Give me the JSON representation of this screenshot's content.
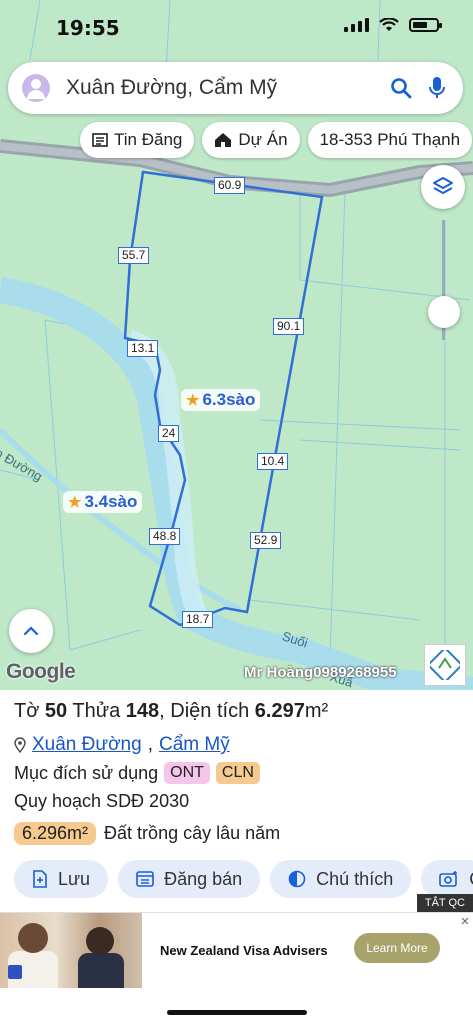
{
  "status": {
    "time": "19:55"
  },
  "search": {
    "query": "Xuân Đường, Cẩm Mỹ"
  },
  "chips": [
    {
      "label": "Tin Đăng",
      "icon": "news-icon"
    },
    {
      "label": "Dự Án",
      "icon": "house-icon"
    },
    {
      "label": "18-353 Phú Thạnh",
      "icon": ""
    }
  ],
  "map": {
    "segments": [
      "60.9",
      "55.7",
      "90.1",
      "13.1",
      "24",
      "10.4",
      "48.8",
      "52.9",
      "18.7"
    ],
    "areas": [
      "6.3sào",
      "3.4sào"
    ],
    "road_labels": [
      "n Đường",
      "Suối",
      "Xuâ"
    ],
    "google": "Google",
    "watermark": "Mr Hoàng0989268955"
  },
  "parcel": {
    "sheet_label": "Tờ",
    "sheet": "50",
    "plot_label": "Thửa",
    "plot": "148",
    "area_label": "Diện tích",
    "area": "6.297",
    "unit": "m²",
    "ward": "Xuân Đường",
    "sep": ",",
    "district": "Cẩm Mỹ",
    "purpose_label": "Mục đích sử dụng",
    "purpose_tags": [
      "ONT",
      "CLN"
    ],
    "plan": "Quy hoạch SDĐ 2030",
    "plan_area": "6.296m²",
    "plan_use": "Đất trồng cây lâu năm"
  },
  "actions": [
    "Lưu",
    "Đăng bán",
    "Chú thích",
    "C"
  ],
  "ad": {
    "close": "TẮT QC",
    "text": "New Zealand Visa Advisers",
    "button": "Learn More"
  },
  "colors": {
    "map_bg": "#bfe8c9",
    "parcel_line": "#2f6fd6",
    "link": "#1a55c9",
    "tag_ont": "#f4c6ec",
    "tag_cln": "#f6c98e"
  }
}
